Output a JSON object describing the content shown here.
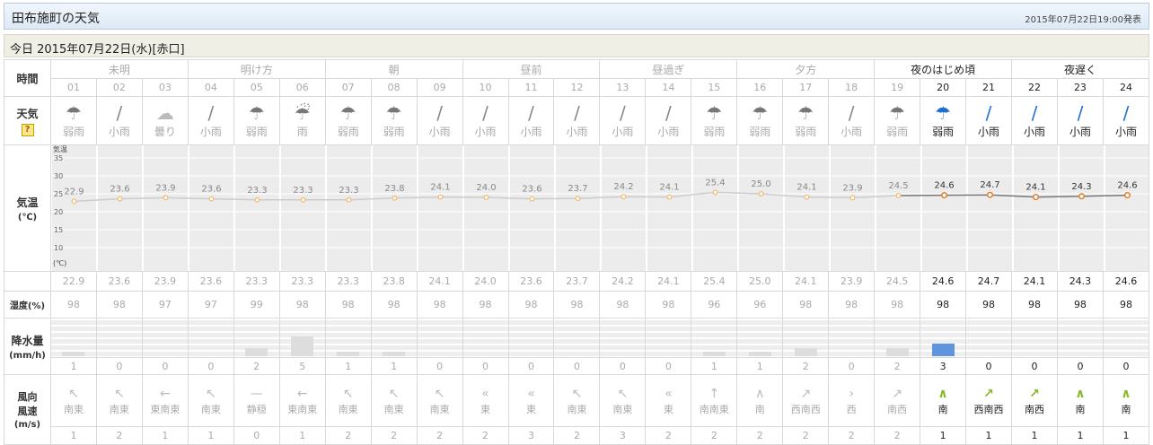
{
  "header": {
    "location": "田布施町の天気",
    "issued": "2015年07月22日19:00発表"
  },
  "day": {
    "title": "今日 2015年07月22日(水)[赤口]"
  },
  "labels": {
    "time": "時間",
    "weather": "天気",
    "temp": "気温",
    "temp_unit": "(℃)",
    "humidity": "湿度(%)",
    "precip": "降水量",
    "precip_unit": "(mm/h)",
    "wind_dir": "風向",
    "wind_speed": "風速",
    "wind_unit": "(m/s)",
    "graph_temp": "気温",
    "graph_unit": "(℃)",
    "help": "?"
  },
  "periods": [
    {
      "label": "未明",
      "span": 3,
      "past": true
    },
    {
      "label": "明け方",
      "span": 3,
      "past": true
    },
    {
      "label": "朝",
      "span": 3,
      "past": true
    },
    {
      "label": "昼前",
      "span": 3,
      "past": true
    },
    {
      "label": "昼過ぎ",
      "span": 3,
      "past": true
    },
    {
      "label": "夕方",
      "span": 3,
      "past": true
    },
    {
      "label": "夜のはじめ頃",
      "span": 3,
      "past": false
    },
    {
      "label": "夜遅く",
      "span": 3,
      "past": false
    }
  ],
  "hours": [
    {
      "h": "01",
      "w": "弱雨",
      "icon": "umbrella",
      "t": "22.9",
      "hum": "98",
      "p": "1",
      "dir": "南東",
      "ws": "1",
      "past": true
    },
    {
      "h": "02",
      "w": "小雨",
      "icon": "closed-umbrella",
      "t": "23.6",
      "hum": "98",
      "p": "0",
      "dir": "南東",
      "ws": "2",
      "past": true
    },
    {
      "h": "03",
      "w": "曇り",
      "icon": "cloud",
      "t": "23.9",
      "hum": "97",
      "p": "0",
      "dir": "東南東",
      "ws": "1",
      "past": true
    },
    {
      "h": "04",
      "w": "小雨",
      "icon": "closed-umbrella",
      "t": "23.6",
      "hum": "97",
      "p": "0",
      "dir": "南東",
      "ws": "1",
      "past": true
    },
    {
      "h": "05",
      "w": "弱雨",
      "icon": "umbrella",
      "t": "23.3",
      "hum": "99",
      "p": "2",
      "dir": "静穏",
      "ws": "0",
      "past": true
    },
    {
      "h": "06",
      "w": "雨",
      "icon": "rain-umbrella",
      "t": "23.3",
      "hum": "98",
      "p": "5",
      "dir": "東南東",
      "ws": "1",
      "past": true
    },
    {
      "h": "07",
      "w": "弱雨",
      "icon": "umbrella",
      "t": "23.3",
      "hum": "98",
      "p": "1",
      "dir": "南東",
      "ws": "2",
      "past": true
    },
    {
      "h": "08",
      "w": "弱雨",
      "icon": "umbrella",
      "t": "23.8",
      "hum": "98",
      "p": "1",
      "dir": "南東",
      "ws": "2",
      "past": true
    },
    {
      "h": "09",
      "w": "小雨",
      "icon": "closed-umbrella",
      "t": "24.1",
      "hum": "98",
      "p": "0",
      "dir": "南東",
      "ws": "2",
      "past": true
    },
    {
      "h": "10",
      "w": "小雨",
      "icon": "closed-umbrella",
      "t": "24.0",
      "hum": "98",
      "p": "0",
      "dir": "東",
      "ws": "2",
      "past": true
    },
    {
      "h": "11",
      "w": "小雨",
      "icon": "closed-umbrella",
      "t": "23.6",
      "hum": "98",
      "p": "0",
      "dir": "東",
      "ws": "3",
      "past": true
    },
    {
      "h": "12",
      "w": "小雨",
      "icon": "closed-umbrella",
      "t": "23.7",
      "hum": "98",
      "p": "0",
      "dir": "南東",
      "ws": "2",
      "past": true
    },
    {
      "h": "13",
      "w": "小雨",
      "icon": "closed-umbrella",
      "t": "24.2",
      "hum": "98",
      "p": "0",
      "dir": "南東",
      "ws": "3",
      "past": true
    },
    {
      "h": "14",
      "w": "小雨",
      "icon": "closed-umbrella",
      "t": "24.1",
      "hum": "98",
      "p": "0",
      "dir": "東",
      "ws": "2",
      "past": true
    },
    {
      "h": "15",
      "w": "弱雨",
      "icon": "umbrella",
      "t": "25.4",
      "hum": "96",
      "p": "1",
      "dir": "南南東",
      "ws": "2",
      "past": true
    },
    {
      "h": "16",
      "w": "弱雨",
      "icon": "umbrella",
      "t": "25.0",
      "hum": "96",
      "p": "1",
      "dir": "南",
      "ws": "2",
      "past": true
    },
    {
      "h": "17",
      "w": "弱雨",
      "icon": "umbrella",
      "t": "24.1",
      "hum": "98",
      "p": "2",
      "dir": "西南西",
      "ws": "2",
      "past": true
    },
    {
      "h": "18",
      "w": "小雨",
      "icon": "closed-umbrella",
      "t": "23.9",
      "hum": "98",
      "p": "0",
      "dir": "西",
      "ws": "2",
      "past": true
    },
    {
      "h": "19",
      "w": "弱雨",
      "icon": "umbrella",
      "t": "24.5",
      "hum": "98",
      "p": "2",
      "dir": "南西",
      "ws": "2",
      "past": true
    },
    {
      "h": "20",
      "w": "弱雨",
      "icon": "umbrella-blue",
      "t": "24.6",
      "hum": "98",
      "p": "3",
      "dir": "南",
      "ws": "1",
      "past": false
    },
    {
      "h": "21",
      "w": "小雨",
      "icon": "closed-umbrella-blue",
      "t": "24.7",
      "hum": "98",
      "p": "0",
      "dir": "西南西",
      "ws": "1",
      "past": false
    },
    {
      "h": "22",
      "w": "小雨",
      "icon": "closed-umbrella-blue",
      "t": "24.1",
      "hum": "98",
      "p": "0",
      "dir": "南西",
      "ws": "1",
      "past": false
    },
    {
      "h": "23",
      "w": "小雨",
      "icon": "closed-umbrella-blue",
      "t": "24.3",
      "hum": "98",
      "p": "0",
      "dir": "南",
      "ws": "1",
      "past": false
    },
    {
      "h": "24",
      "w": "小雨",
      "icon": "closed-umbrella-blue",
      "t": "24.6",
      "hum": "98",
      "p": "0",
      "dir": "南",
      "ws": "1",
      "past": false
    }
  ],
  "graph_axis": [
    "35",
    "30",
    "25",
    "20",
    "15",
    "10"
  ],
  "graph_range": [
    5,
    37
  ],
  "colors": {
    "past": "#aaaaaa",
    "current": "#222222",
    "rain_bar": "#5e95dc",
    "wind_now": "#8ab82a",
    "temp_point": "#f0a040"
  }
}
